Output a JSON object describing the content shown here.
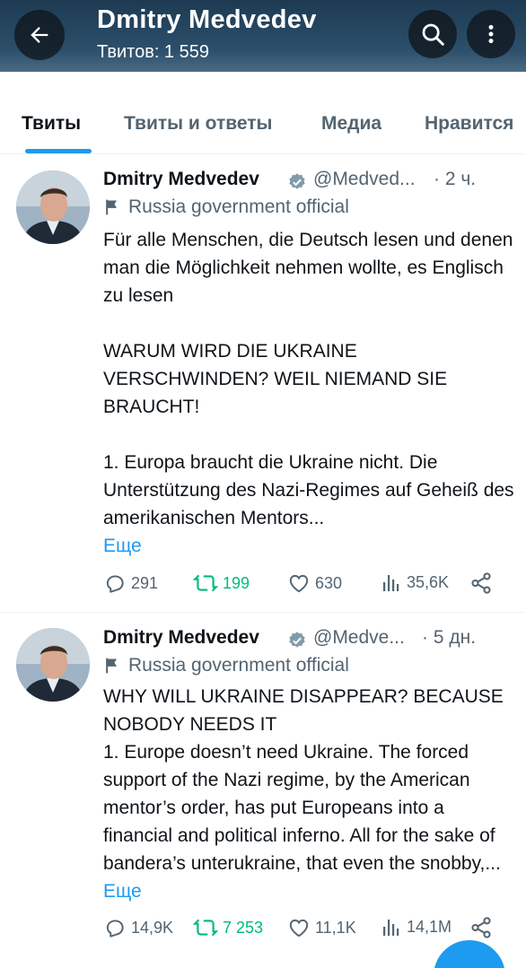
{
  "header": {
    "title": "Dmitry Medvedev",
    "subtitle": "Твитов: 1 559",
    "back_icon": "arrow-left-icon",
    "search_icon": "search-icon",
    "more_icon": "more-vertical-icon"
  },
  "tabs": [
    {
      "label": "Твиты",
      "active": true
    },
    {
      "label": "Твиты и ответы",
      "active": false
    },
    {
      "label": "Медиа",
      "active": false
    },
    {
      "label": "Нравится",
      "active": false
    }
  ],
  "tweets": [
    {
      "name": "Dmitry Medvedev",
      "handle": "@Medved...",
      "time": "· 2 ч.",
      "label": "Russia government official",
      "paragraphs": [
        "Für alle Menschen, die Deutsch lesen und denen man die Möglichkeit nehmen wollte, es Englisch zu lesen",
        "WARUM WIRD DIE UKRAINE VERSCHWINDEN? WEIL NIEMAND SIE BRAUCHT!",
        "1. Europa braucht die Ukraine nicht. Die Unterstützung des Nazi-Regimes auf Geheiß des amerikanischen Mentors..."
      ],
      "more": "Еще",
      "replies": "291",
      "retweets": "199",
      "likes": "630",
      "views": "35,6K"
    },
    {
      "name": "Dmitry Medvedev",
      "handle": "@Medve...",
      "time": "· 5 дн.",
      "label": "Russia government official",
      "text": "WHY WILL UKRAINE DISAPPEAR? BECAUSE NOBODY NEEDS IT\n1. Europe doesn’t need Ukraine. The forced support of the Nazi regime, by the American mentor’s order, has put Europeans into a financial and political inferno. All for the sake of bandera’s unterukraine, that even the snobby,...",
      "more": "Еще",
      "replies": "14,9K",
      "retweets": "7 253",
      "likes": "11,1K",
      "views": "14,1M"
    }
  ],
  "colors": {
    "accent": "#1d9bf0",
    "retweet": "#00ba7c",
    "secondary_text": "#536471",
    "verified_badge": "#829aab"
  }
}
